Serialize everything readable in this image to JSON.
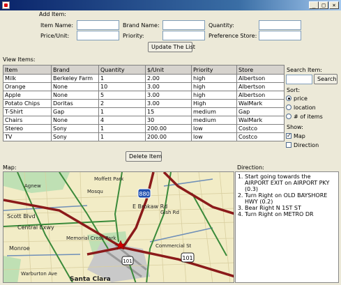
{
  "window": {
    "minimize": "_",
    "maximize": "□",
    "close": "×"
  },
  "add_item": {
    "heading": "Add Item:",
    "item_name_label": "Item Name:",
    "brand_name_label": "Brand Name:",
    "quantity_label": "Quantity:",
    "price_unit_label": "Price/Unit:",
    "priority_label": "Priority:",
    "preference_store_label": "Preference Store:",
    "update_button": "Update The List"
  },
  "view_items": {
    "heading": "View Items:",
    "columns": [
      "Item",
      "Brand",
      "Quantity",
      "$/Unit",
      "Priority",
      "Store"
    ],
    "rows": [
      [
        "Milk",
        "Berkeley Farm",
        "1",
        "2.00",
        "high",
        "Albertson"
      ],
      [
        "Orange",
        "None",
        "10",
        "3.00",
        "high",
        "Albertson"
      ],
      [
        "Apple",
        "None",
        "5",
        "3.00",
        "high",
        "Albertson"
      ],
      [
        "Potato Chips",
        "Doritas",
        "2",
        "3.00",
        "High",
        "WalMark"
      ],
      [
        "T-Shirt",
        "Gap",
        "1",
        "15",
        "medium",
        "Gap"
      ],
      [
        "Chairs",
        "None",
        "4",
        "30",
        "medium",
        "WalMark"
      ],
      [
        "Stereo",
        "Sony",
        "1",
        "200.00",
        "low",
        "Costco"
      ],
      [
        "TV",
        "Sony",
        "1",
        "200.00",
        "low",
        "Costco"
      ]
    ],
    "delete_button": "Delete Item"
  },
  "side": {
    "search_label": "Search Item:",
    "search_value": "",
    "search_button": "Search",
    "sort_label": "Sort:",
    "sort_options": [
      "price",
      "location",
      "# of items"
    ],
    "sort_selected": "price",
    "show_label": "Show:",
    "show_map": "Map",
    "show_map_checked": true,
    "show_direction": "Direction",
    "show_direction_checked": false
  },
  "map": {
    "label": "Map:",
    "places": [
      "Agnew",
      "Moffett Park",
      "Scott Blvd",
      "Central Exwy",
      "Monroe",
      "Memorial Cross Park",
      "Warburton Ave",
      "Santa Clara",
      "E Brokaw Rd",
      "Commercial St",
      "Gish Rd",
      "Mosqu"
    ],
    "highways": [
      "880",
      "101",
      "101"
    ]
  },
  "directions": {
    "label": "Direction:",
    "steps": [
      "Start going towards the AIRPORT EXIT on AIRPORT PKY (0.3)",
      "Turn Right on OLD BAYSHORE HWY (0.2)",
      "Bear Right N 1ST ST",
      "Turn Right on METRO DR"
    ]
  },
  "colors": {
    "title_bar": "#0a246a",
    "map_land": "#f2ecc6",
    "map_highway": "#8b1a1a",
    "map_road_green": "#3a8a3a",
    "map_road_blue": "#6f8fb8",
    "map_park": "#bfe0b4"
  }
}
